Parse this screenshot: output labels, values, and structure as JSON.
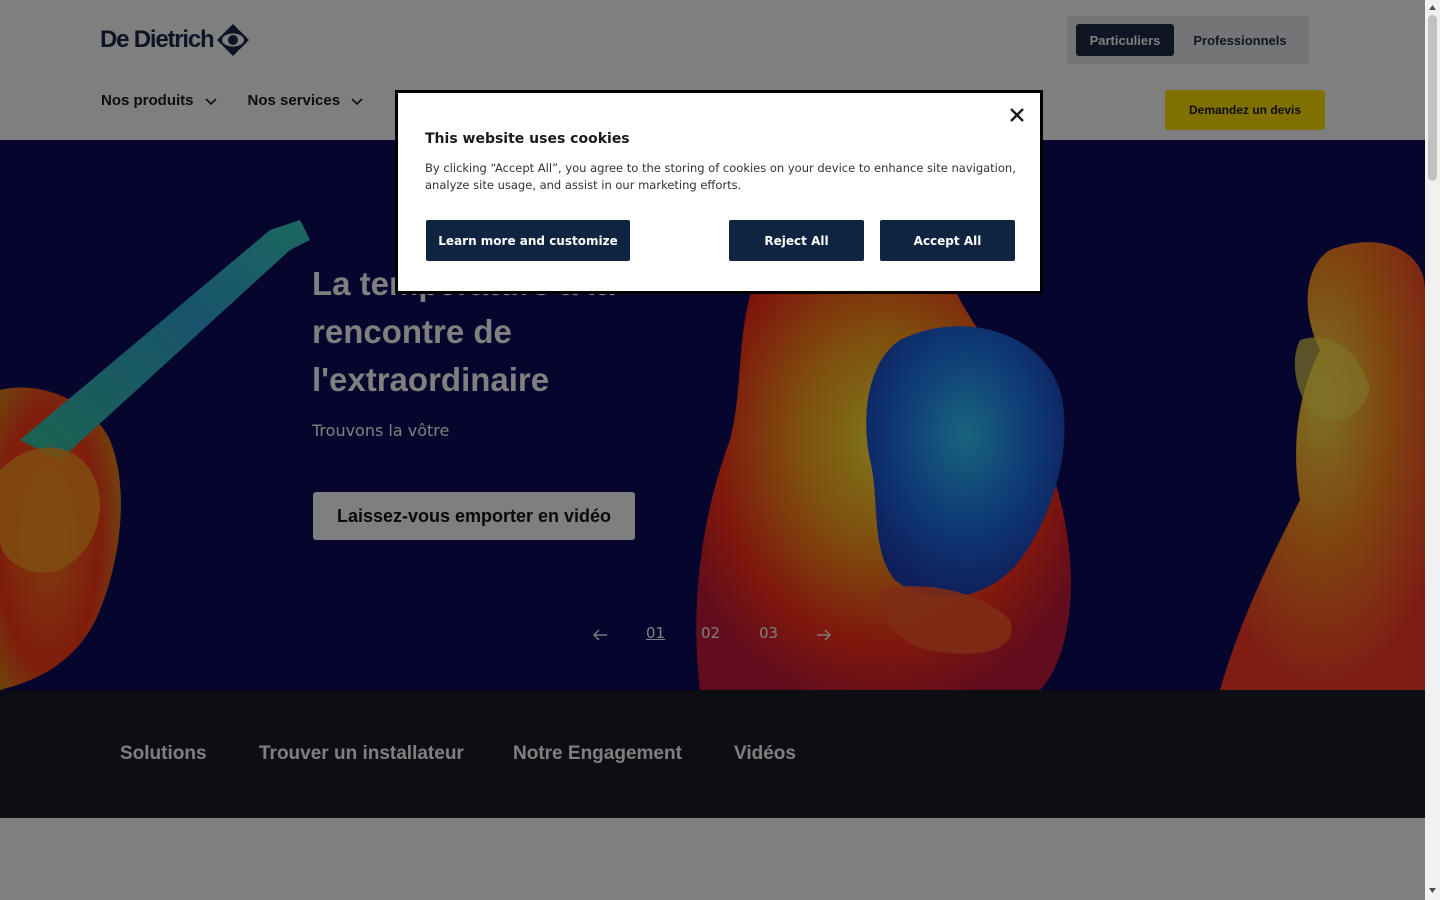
{
  "header": {
    "brand": "De Dietrich",
    "audience_tabs": [
      {
        "label": "Particuliers",
        "active": true
      },
      {
        "label": "Professionnels",
        "active": false
      }
    ],
    "nav": [
      {
        "label": "Nos produits",
        "icon": "chevron-down-icon"
      },
      {
        "label": "Nos services",
        "icon": "chevron-down-icon"
      }
    ],
    "cta_label": "Demandez un devis"
  },
  "hero": {
    "title": "La température à la rencontre de l'extraordinaire",
    "subtitle": "Trouvons la vôtre",
    "button_label": "Laissez-vous emporter en vidéo",
    "pager": {
      "pages": [
        "01",
        "02",
        "03"
      ],
      "active_index": 0,
      "prev_icon": "arrow-left-icon",
      "next_icon": "arrow-right-icon"
    }
  },
  "subnav": {
    "items": [
      "Solutions",
      "Trouver un installateur",
      "Notre Engagement",
      "Vidéos"
    ]
  },
  "cookie_dialog": {
    "title": "This website uses cookies",
    "body": "By clicking “Accept All”, you agree to the storing of cookies on your device to enhance site navigation, analyze site usage, and assist in our marketing efforts.",
    "buttons": {
      "learn": "Learn more and customize",
      "reject": "Reject All",
      "accept": "Accept All"
    },
    "close_icon": "close-icon"
  },
  "colors": {
    "brand_navy": "#1f2a44",
    "cta_yellow": "#ffe000",
    "hero_bg": "#0c0b5a",
    "subnav_bg": "#1a1d28",
    "dialog_button": "#0f2440"
  }
}
